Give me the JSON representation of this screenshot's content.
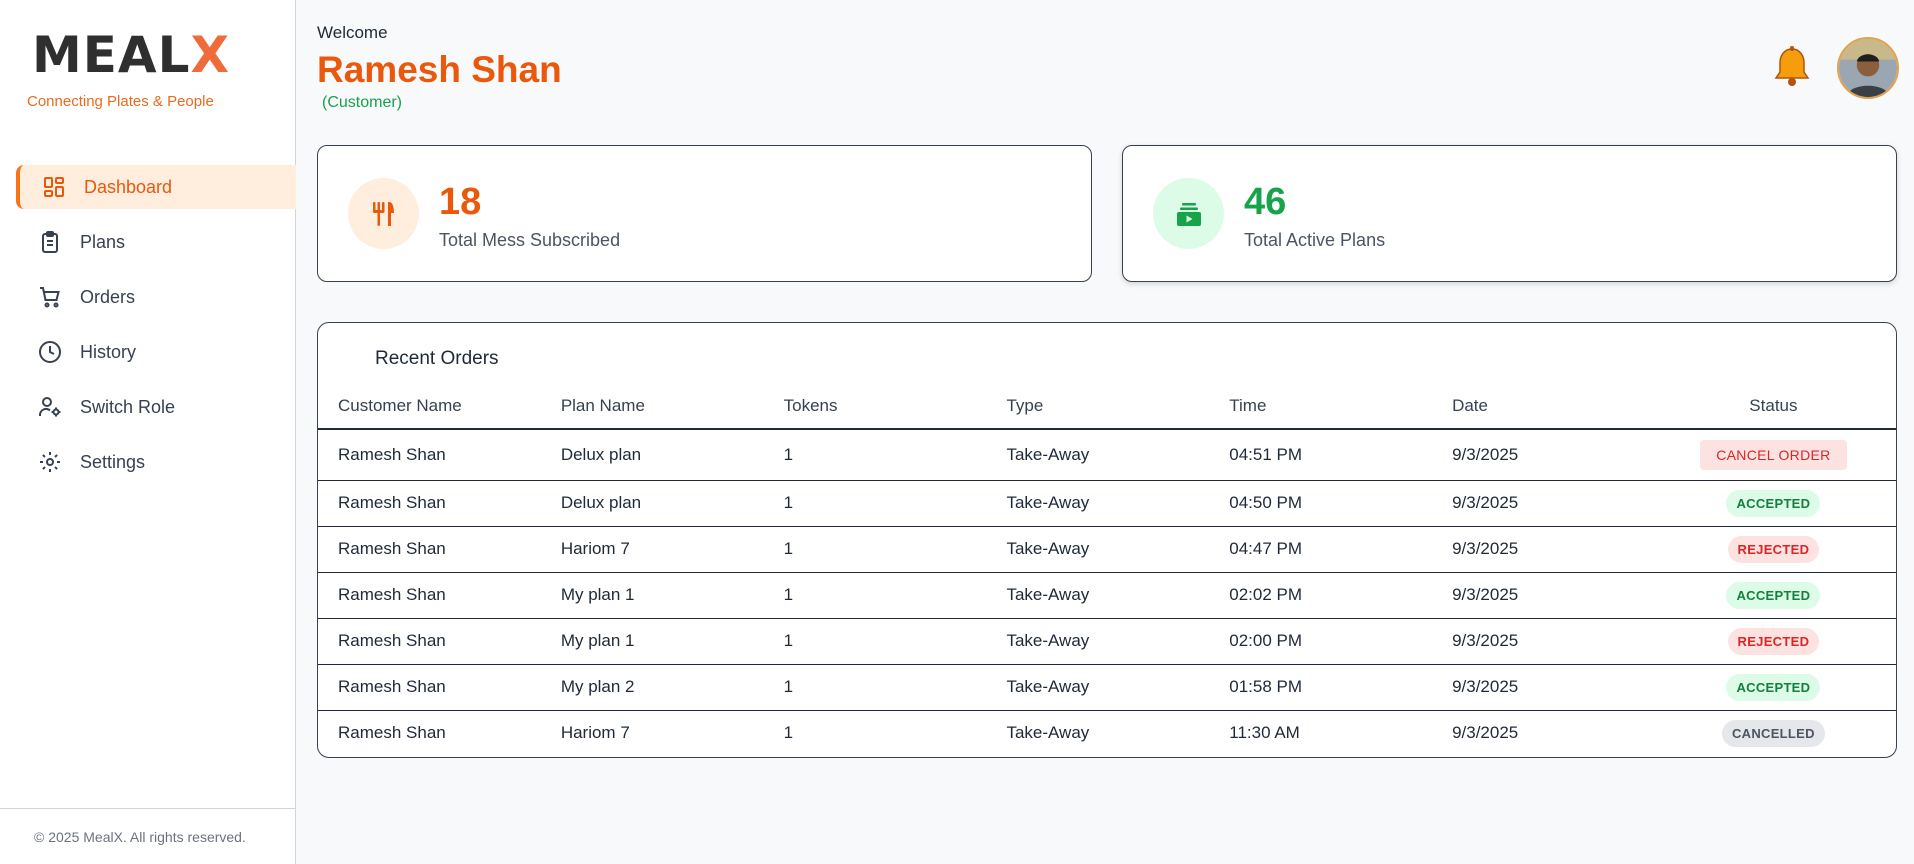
{
  "brand": {
    "logo_main": "MEAL",
    "logo_x": "X",
    "tagline": "Connecting Plates & People"
  },
  "sidebar": {
    "items": [
      {
        "label": "Dashboard",
        "icon": "dashboard-icon",
        "active": true
      },
      {
        "label": "Plans",
        "icon": "clipboard-icon"
      },
      {
        "label": "Orders",
        "icon": "cart-icon"
      },
      {
        "label": "History",
        "icon": "clock-icon"
      },
      {
        "label": "Switch Role",
        "icon": "user-gear-icon"
      },
      {
        "label": "Settings",
        "icon": "gear-icon"
      }
    ],
    "footer": "© 2025 MealX. All rights reserved."
  },
  "header": {
    "welcome": "Welcome",
    "user_name": "Ramesh Shan",
    "role": "(Customer)"
  },
  "stats": [
    {
      "value": "18",
      "label": "Total Mess Subscribed",
      "color": "#ea580c",
      "icon": "utensils-icon"
    },
    {
      "value": "46",
      "label": "Total Active Plans",
      "color": "#16a34a",
      "icon": "plans-stack-icon"
    }
  ],
  "orders": {
    "title": "Recent Orders",
    "columns": [
      "Customer Name",
      "Plan Name",
      "Tokens",
      "Type",
      "Time",
      "Date",
      "Status"
    ],
    "rows": [
      {
        "customer": "Ramesh Shan",
        "plan": "Delux plan",
        "tokens": "1",
        "type": "Take-Away",
        "time": "04:51 PM",
        "date": "9/3/2025",
        "status": "CANCEL ORDER",
        "status_kind": "cancel-order"
      },
      {
        "customer": "Ramesh Shan",
        "plan": "Delux plan",
        "tokens": "1",
        "type": "Take-Away",
        "time": "04:50 PM",
        "date": "9/3/2025",
        "status": "ACCEPTED",
        "status_kind": "accepted"
      },
      {
        "customer": "Ramesh Shan",
        "plan": "Hariom 7",
        "tokens": "1",
        "type": "Take-Away",
        "time": "04:47 PM",
        "date": "9/3/2025",
        "status": "REJECTED",
        "status_kind": "rejected"
      },
      {
        "customer": "Ramesh Shan",
        "plan": "My plan 1",
        "tokens": "1",
        "type": "Take-Away",
        "time": "02:02 PM",
        "date": "9/3/2025",
        "status": "ACCEPTED",
        "status_kind": "accepted"
      },
      {
        "customer": "Ramesh Shan",
        "plan": "My plan 1",
        "tokens": "1",
        "type": "Take-Away",
        "time": "02:00 PM",
        "date": "9/3/2025",
        "status": "REJECTED",
        "status_kind": "rejected"
      },
      {
        "customer": "Ramesh Shan",
        "plan": "My plan 2",
        "tokens": "1",
        "type": "Take-Away",
        "time": "01:58 PM",
        "date": "9/3/2025",
        "status": "ACCEPTED",
        "status_kind": "accepted"
      },
      {
        "customer": "Ramesh Shan",
        "plan": "Hariom 7",
        "tokens": "1",
        "type": "Take-Away",
        "time": "11:30 AM",
        "date": "9/3/2025",
        "status": "CANCELLED",
        "status_kind": "cancelled"
      }
    ]
  },
  "colors": {
    "accent": "#ea580c",
    "success": "#16a34a",
    "danger": "#dc2626"
  }
}
